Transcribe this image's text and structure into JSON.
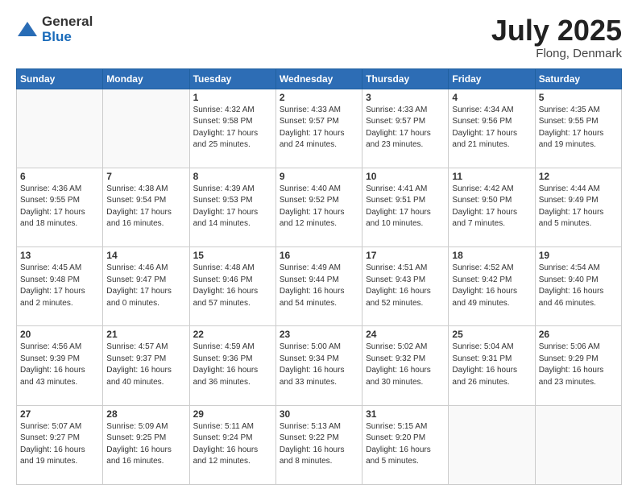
{
  "header": {
    "logo_general": "General",
    "logo_blue": "Blue",
    "month_title": "July 2025",
    "location": "Flong, Denmark"
  },
  "weekdays": [
    "Sunday",
    "Monday",
    "Tuesday",
    "Wednesday",
    "Thursday",
    "Friday",
    "Saturday"
  ],
  "weeks": [
    [
      {
        "day": null
      },
      {
        "day": null
      },
      {
        "day": "1",
        "sunrise": "Sunrise: 4:32 AM",
        "sunset": "Sunset: 9:58 PM",
        "daylight": "Daylight: 17 hours and 25 minutes."
      },
      {
        "day": "2",
        "sunrise": "Sunrise: 4:33 AM",
        "sunset": "Sunset: 9:57 PM",
        "daylight": "Daylight: 17 hours and 24 minutes."
      },
      {
        "day": "3",
        "sunrise": "Sunrise: 4:33 AM",
        "sunset": "Sunset: 9:57 PM",
        "daylight": "Daylight: 17 hours and 23 minutes."
      },
      {
        "day": "4",
        "sunrise": "Sunrise: 4:34 AM",
        "sunset": "Sunset: 9:56 PM",
        "daylight": "Daylight: 17 hours and 21 minutes."
      },
      {
        "day": "5",
        "sunrise": "Sunrise: 4:35 AM",
        "sunset": "Sunset: 9:55 PM",
        "daylight": "Daylight: 17 hours and 19 minutes."
      }
    ],
    [
      {
        "day": "6",
        "sunrise": "Sunrise: 4:36 AM",
        "sunset": "Sunset: 9:55 PM",
        "daylight": "Daylight: 17 hours and 18 minutes."
      },
      {
        "day": "7",
        "sunrise": "Sunrise: 4:38 AM",
        "sunset": "Sunset: 9:54 PM",
        "daylight": "Daylight: 17 hours and 16 minutes."
      },
      {
        "day": "8",
        "sunrise": "Sunrise: 4:39 AM",
        "sunset": "Sunset: 9:53 PM",
        "daylight": "Daylight: 17 hours and 14 minutes."
      },
      {
        "day": "9",
        "sunrise": "Sunrise: 4:40 AM",
        "sunset": "Sunset: 9:52 PM",
        "daylight": "Daylight: 17 hours and 12 minutes."
      },
      {
        "day": "10",
        "sunrise": "Sunrise: 4:41 AM",
        "sunset": "Sunset: 9:51 PM",
        "daylight": "Daylight: 17 hours and 10 minutes."
      },
      {
        "day": "11",
        "sunrise": "Sunrise: 4:42 AM",
        "sunset": "Sunset: 9:50 PM",
        "daylight": "Daylight: 17 hours and 7 minutes."
      },
      {
        "day": "12",
        "sunrise": "Sunrise: 4:44 AM",
        "sunset": "Sunset: 9:49 PM",
        "daylight": "Daylight: 17 hours and 5 minutes."
      }
    ],
    [
      {
        "day": "13",
        "sunrise": "Sunrise: 4:45 AM",
        "sunset": "Sunset: 9:48 PM",
        "daylight": "Daylight: 17 hours and 2 minutes."
      },
      {
        "day": "14",
        "sunrise": "Sunrise: 4:46 AM",
        "sunset": "Sunset: 9:47 PM",
        "daylight": "Daylight: 17 hours and 0 minutes."
      },
      {
        "day": "15",
        "sunrise": "Sunrise: 4:48 AM",
        "sunset": "Sunset: 9:46 PM",
        "daylight": "Daylight: 16 hours and 57 minutes."
      },
      {
        "day": "16",
        "sunrise": "Sunrise: 4:49 AM",
        "sunset": "Sunset: 9:44 PM",
        "daylight": "Daylight: 16 hours and 54 minutes."
      },
      {
        "day": "17",
        "sunrise": "Sunrise: 4:51 AM",
        "sunset": "Sunset: 9:43 PM",
        "daylight": "Daylight: 16 hours and 52 minutes."
      },
      {
        "day": "18",
        "sunrise": "Sunrise: 4:52 AM",
        "sunset": "Sunset: 9:42 PM",
        "daylight": "Daylight: 16 hours and 49 minutes."
      },
      {
        "day": "19",
        "sunrise": "Sunrise: 4:54 AM",
        "sunset": "Sunset: 9:40 PM",
        "daylight": "Daylight: 16 hours and 46 minutes."
      }
    ],
    [
      {
        "day": "20",
        "sunrise": "Sunrise: 4:56 AM",
        "sunset": "Sunset: 9:39 PM",
        "daylight": "Daylight: 16 hours and 43 minutes."
      },
      {
        "day": "21",
        "sunrise": "Sunrise: 4:57 AM",
        "sunset": "Sunset: 9:37 PM",
        "daylight": "Daylight: 16 hours and 40 minutes."
      },
      {
        "day": "22",
        "sunrise": "Sunrise: 4:59 AM",
        "sunset": "Sunset: 9:36 PM",
        "daylight": "Daylight: 16 hours and 36 minutes."
      },
      {
        "day": "23",
        "sunrise": "Sunrise: 5:00 AM",
        "sunset": "Sunset: 9:34 PM",
        "daylight": "Daylight: 16 hours and 33 minutes."
      },
      {
        "day": "24",
        "sunrise": "Sunrise: 5:02 AM",
        "sunset": "Sunset: 9:32 PM",
        "daylight": "Daylight: 16 hours and 30 minutes."
      },
      {
        "day": "25",
        "sunrise": "Sunrise: 5:04 AM",
        "sunset": "Sunset: 9:31 PM",
        "daylight": "Daylight: 16 hours and 26 minutes."
      },
      {
        "day": "26",
        "sunrise": "Sunrise: 5:06 AM",
        "sunset": "Sunset: 9:29 PM",
        "daylight": "Daylight: 16 hours and 23 minutes."
      }
    ],
    [
      {
        "day": "27",
        "sunrise": "Sunrise: 5:07 AM",
        "sunset": "Sunset: 9:27 PM",
        "daylight": "Daylight: 16 hours and 19 minutes."
      },
      {
        "day": "28",
        "sunrise": "Sunrise: 5:09 AM",
        "sunset": "Sunset: 9:25 PM",
        "daylight": "Daylight: 16 hours and 16 minutes."
      },
      {
        "day": "29",
        "sunrise": "Sunrise: 5:11 AM",
        "sunset": "Sunset: 9:24 PM",
        "daylight": "Daylight: 16 hours and 12 minutes."
      },
      {
        "day": "30",
        "sunrise": "Sunrise: 5:13 AM",
        "sunset": "Sunset: 9:22 PM",
        "daylight": "Daylight: 16 hours and 8 minutes."
      },
      {
        "day": "31",
        "sunrise": "Sunrise: 5:15 AM",
        "sunset": "Sunset: 9:20 PM",
        "daylight": "Daylight: 16 hours and 5 minutes."
      },
      {
        "day": null
      },
      {
        "day": null
      }
    ]
  ]
}
